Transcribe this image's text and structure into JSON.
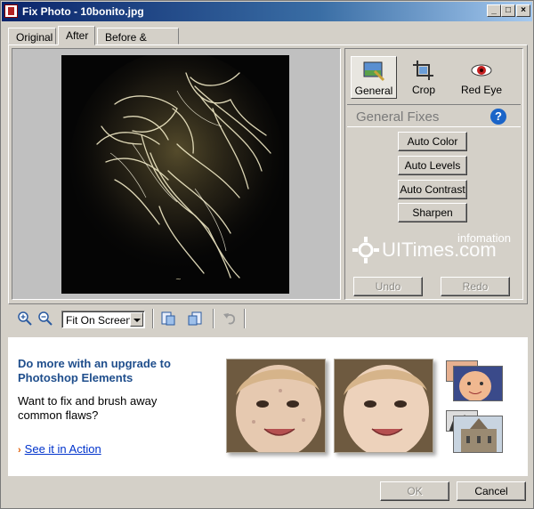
{
  "window": {
    "title": "Fix Photo - 10bonito.jpg"
  },
  "tabs": [
    {
      "label": "Original",
      "active": false
    },
    {
      "label": "After",
      "active": true
    },
    {
      "label": "Before & After",
      "active": false
    }
  ],
  "tools": [
    {
      "label": "General",
      "icon": "general-fix-icon",
      "selected": true
    },
    {
      "label": "Crop",
      "icon": "crop-icon",
      "selected": false
    },
    {
      "label": "Red Eye",
      "icon": "red-eye-icon",
      "selected": false
    }
  ],
  "section": {
    "title": "General Fixes",
    "help_icon": "help-icon"
  },
  "fixes": [
    "Auto Color",
    "Auto Levels",
    "Auto Contrast",
    "Sharpen"
  ],
  "history": {
    "undo": "Undo",
    "redo": "Redo"
  },
  "watermark": {
    "main": "UITimes.com",
    "sub": "infomation"
  },
  "zoom": {
    "selected": "Fit On Screen"
  },
  "promo": {
    "title": "Do more with an upgrade to Photoshop Elements",
    "text": "Want to fix and brush away common flaws?",
    "link": "See it in Action"
  },
  "footer": {
    "ok": "OK",
    "cancel": "Cancel"
  },
  "colors": {
    "accent": "#1f4e8c",
    "link": "#0033cc",
    "title_bar": "#0a246a"
  }
}
